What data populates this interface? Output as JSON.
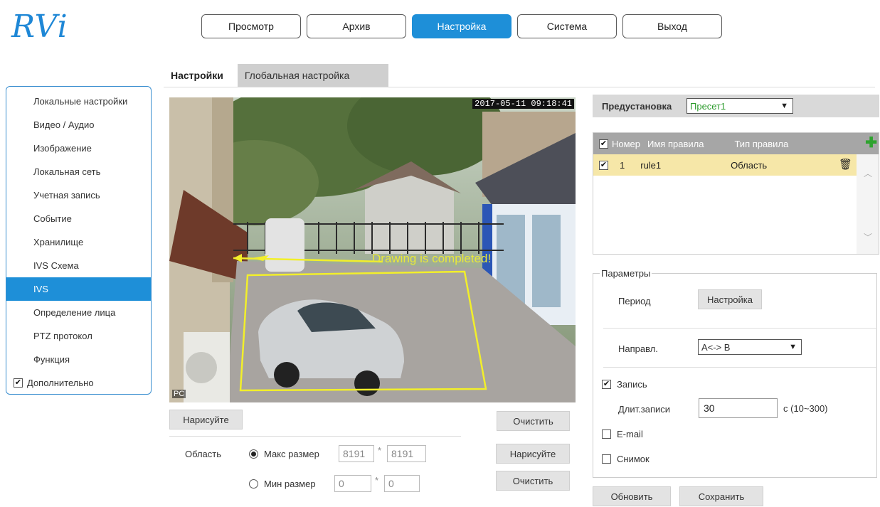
{
  "brand": {
    "logo": "RVi"
  },
  "nav": [
    "Просмотр",
    "Архив",
    "Настройка",
    "Система",
    "Выход"
  ],
  "nav_active": 2,
  "tabs": {
    "active": "Настройки",
    "inactive": "Глобальная настройка"
  },
  "sidebar": {
    "items": [
      "Локальные настройки",
      "Видео / Аудио",
      "Изображение",
      "Локальная сеть",
      "Учетная запись",
      "Событие",
      "Хранилище",
      "IVS Схема",
      "IVS",
      "Определение лица",
      "PTZ протокол",
      "Функция"
    ],
    "active_index": 8,
    "advanced": {
      "label": "Дополнительно",
      "checked": true
    }
  },
  "video": {
    "timestamp": "2017-05-11 09:18:41",
    "message": "Drawing is completed!",
    "corner_label": "PC"
  },
  "draw_controls": {
    "draw": "Нарисуйте",
    "clear": "Очистить",
    "area_label": "Область",
    "max_label": "Макс размер",
    "max_w": "8191",
    "max_h": "8191",
    "min_label": "Мин размер",
    "min_w": "0",
    "min_h": "0",
    "draw2": "Нарисуйте",
    "clear2": "Очистить",
    "times": "*"
  },
  "preset": {
    "label": "Предустановка",
    "value": "Пресет1"
  },
  "rules": {
    "headers": {
      "num": "Номер",
      "name": "Имя правила",
      "type": "Тип правила"
    },
    "rows": [
      {
        "checked": true,
        "num": "1",
        "name": "rule1",
        "type": "Область"
      }
    ]
  },
  "params": {
    "title": "Параметры",
    "period_label": "Период",
    "period_button": "Настройка",
    "direction_label": "Направл.",
    "direction_value": "A<-> B",
    "record": {
      "label": "Запись",
      "checked": true
    },
    "record_duration_label": "Длит.записи",
    "record_duration_value": "30",
    "record_range": "с (10~300)",
    "email": {
      "label": "E-mail",
      "checked": false
    },
    "snapshot": {
      "label": "Снимок",
      "checked": false
    }
  },
  "actions": {
    "refresh": "Обновить",
    "save": "Сохранить"
  },
  "colors": {
    "accent": "#1e8fd8",
    "rule_row": "#f6e7a8",
    "add": "#2fa32f",
    "draw_line": "#f2ef2a"
  }
}
